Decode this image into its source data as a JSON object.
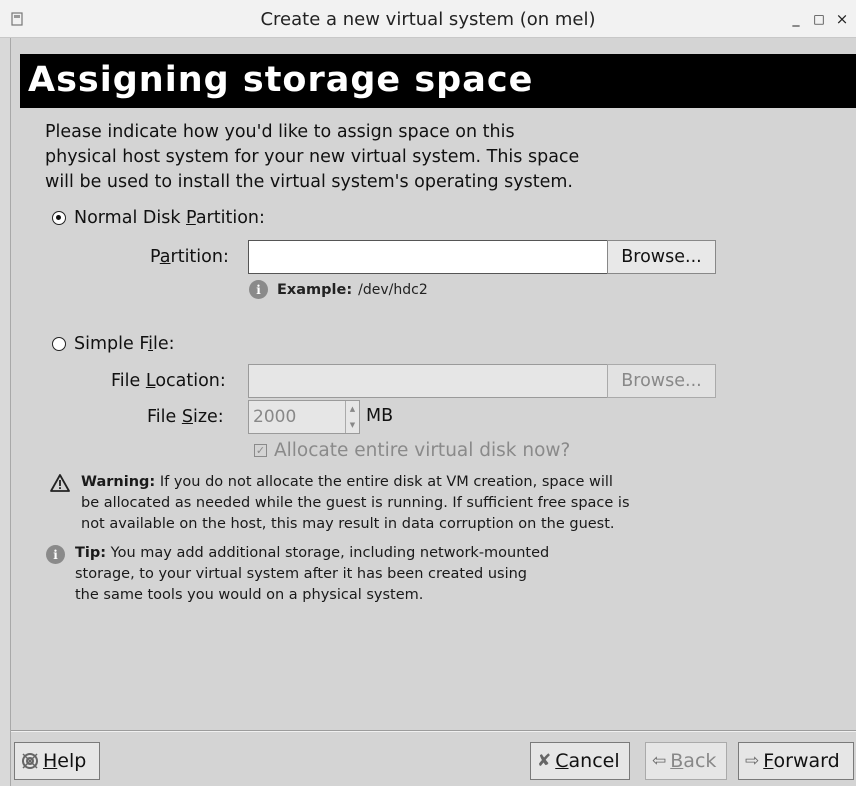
{
  "window": {
    "title": "Create a new virtual system (on mel)",
    "minimize": "_",
    "maximize": "□",
    "close": "×"
  },
  "heading": "Assigning storage space",
  "intro_lines": [
    "Please indicate how you'd like to assign space on this",
    "physical host system for your new virtual system. This space",
    "will be used to install the virtual system's operating system."
  ],
  "partition_option": {
    "label_pre": "Normal Disk ",
    "label_mnemonic": "P",
    "label_post": "artition:",
    "selected": true,
    "field_label_pre": "P",
    "field_label_mnemonic": "a",
    "field_label_post": "rtition:",
    "value": "",
    "browse": "Browse...",
    "example_label": "Example:",
    "example_value": "/dev/hdc2"
  },
  "file_option": {
    "label_pre": "Simple F",
    "label_mnemonic": "i",
    "label_post": "le:",
    "selected": false,
    "location_label_pre": "File ",
    "location_label_mnemonic": "L",
    "location_label_post": "ocation:",
    "location_value": "",
    "browse": "Browse...",
    "size_label_pre": "File ",
    "size_label_mnemonic": "S",
    "size_label_post": "ize:",
    "size_value": "2000",
    "size_unit": "MB",
    "allocate_label": "Allocate entire virtual disk now?",
    "allocate_checked": true
  },
  "warning": {
    "label": "Warning:",
    "line1": " If you do not allocate the entire disk at VM creation, space will",
    "line2": "be allocated as needed while the guest is running. If sufficient free space is",
    "line3": "not available on the host, this may result in data corruption on the guest."
  },
  "tip": {
    "label": "Tip:",
    "line1": " You may add additional storage, including network-mounted",
    "line2": "storage, to your virtual system after it has been created using",
    "line3": "the same tools you would on a physical system."
  },
  "buttons": {
    "help_mnemonic": "H",
    "help_rest": "elp",
    "cancel_mnemonic": "C",
    "cancel_rest": "ancel",
    "back_mnemonic": "B",
    "back_rest": "ack",
    "forward_mnemonic": "F",
    "forward_rest": "orward"
  },
  "icons": {
    "app": "window-icon",
    "info": "info-icon",
    "warning": "warning-icon",
    "help": "help-icon",
    "cancel": "cancel-icon",
    "back": "back-arrow-icon",
    "forward": "forward-arrow-icon"
  }
}
